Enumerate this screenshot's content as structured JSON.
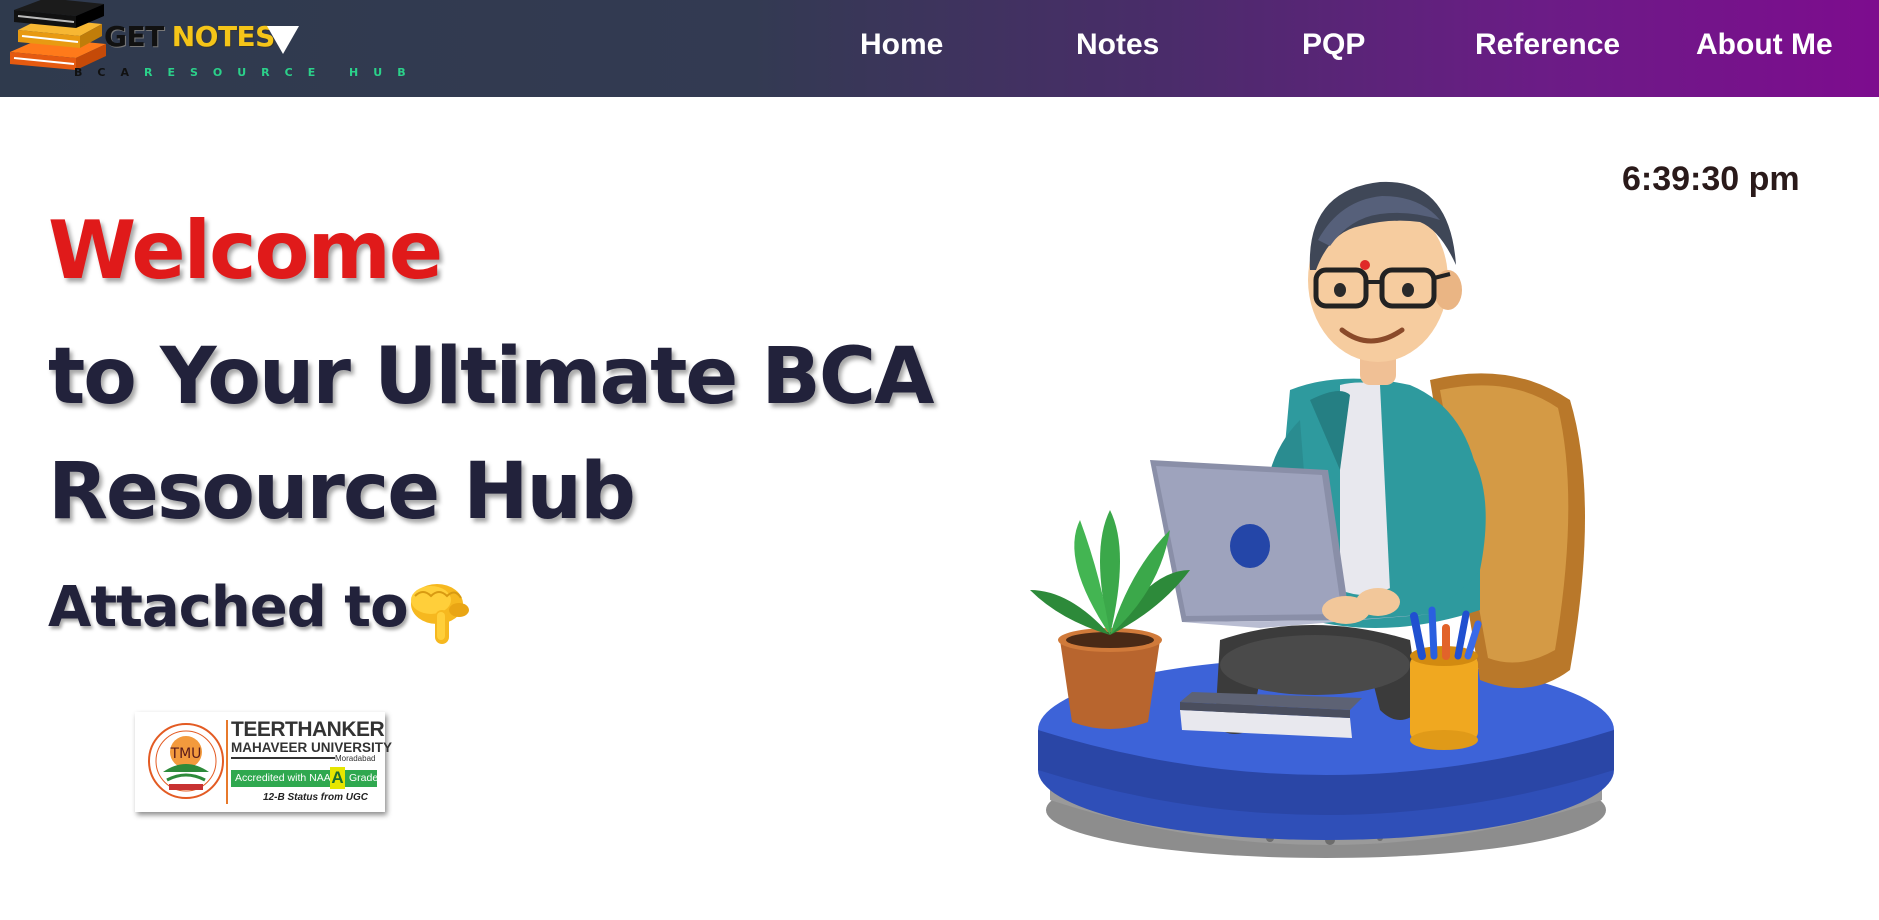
{
  "brand": {
    "word_get": "GET",
    "word_notes": "NOTES",
    "sub_dark": "BCA",
    "sub_light": "RESOURCE HUB",
    "icon": "book-stack-icon"
  },
  "nav": {
    "links": [
      {
        "label": "Home"
      },
      {
        "label": "Notes"
      },
      {
        "label": "PQP"
      },
      {
        "label": "Reference"
      },
      {
        "label": "About Me"
      }
    ]
  },
  "hero": {
    "welcome": "Welcome",
    "tagline_line1": "to Your Ultimate BCA",
    "tagline_line2": "Resource Hub",
    "attached": "Attached to",
    "pointing_icon": "pointing-down-hand-icon"
  },
  "affiliation": {
    "seal_text": "TMU",
    "name": "TEERTHANKER",
    "sub_name": "MAHAVEER UNIVERSITY",
    "city": "Moradabad",
    "accreditation_prefix": "Accredited with NAAC",
    "grade": "A",
    "accreditation_suffix": "Grade",
    "ugc_status": "12-B Status from UGC"
  },
  "clock": {
    "time": "6:39:30 pm"
  },
  "illustration": {
    "icon": "student-on-laptop-illustration"
  },
  "colors": {
    "welcome_red": "#e01a1a",
    "heading_dark": "#22223b",
    "nav_gradient_start": "#2f3a4d",
    "nav_gradient_end": "#7d0c8e",
    "logo_yellow": "#f5c518",
    "logo_green": "#2bd18a"
  }
}
